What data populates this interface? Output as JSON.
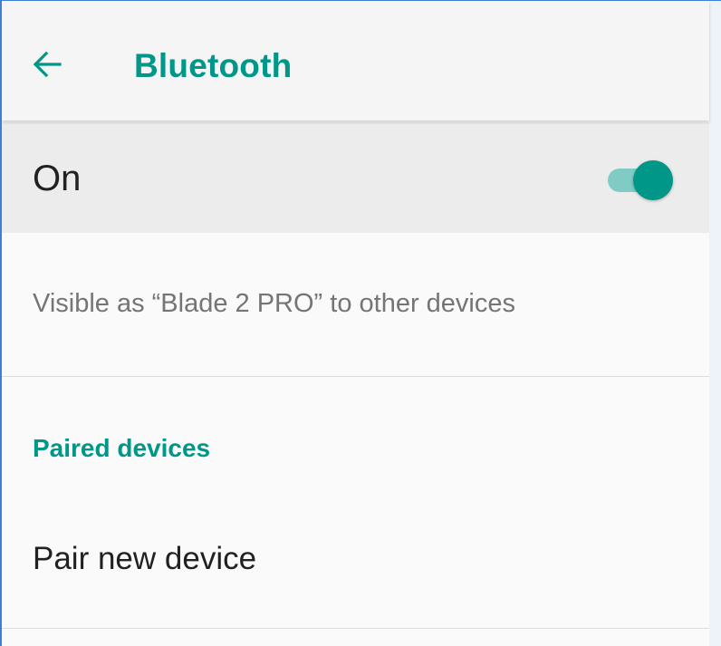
{
  "app_bar": {
    "back_icon": "arrow-back-icon",
    "title": "Bluetooth"
  },
  "master_switch": {
    "label": "On",
    "state": true
  },
  "visibility": {
    "text": "Visible as “Blade 2 PRO” to other devices"
  },
  "paired_section": {
    "header": "Paired devices"
  },
  "pair_new": {
    "label": "Pair new device"
  },
  "colors": {
    "accent": "#009688",
    "switch_track": "#80cbc4",
    "app_bar_bg": "#f5f5f5",
    "master_row_bg": "#ececec",
    "screen_bg": "#fafafa",
    "primary_text": "#212121",
    "secondary_text": "#757575"
  }
}
